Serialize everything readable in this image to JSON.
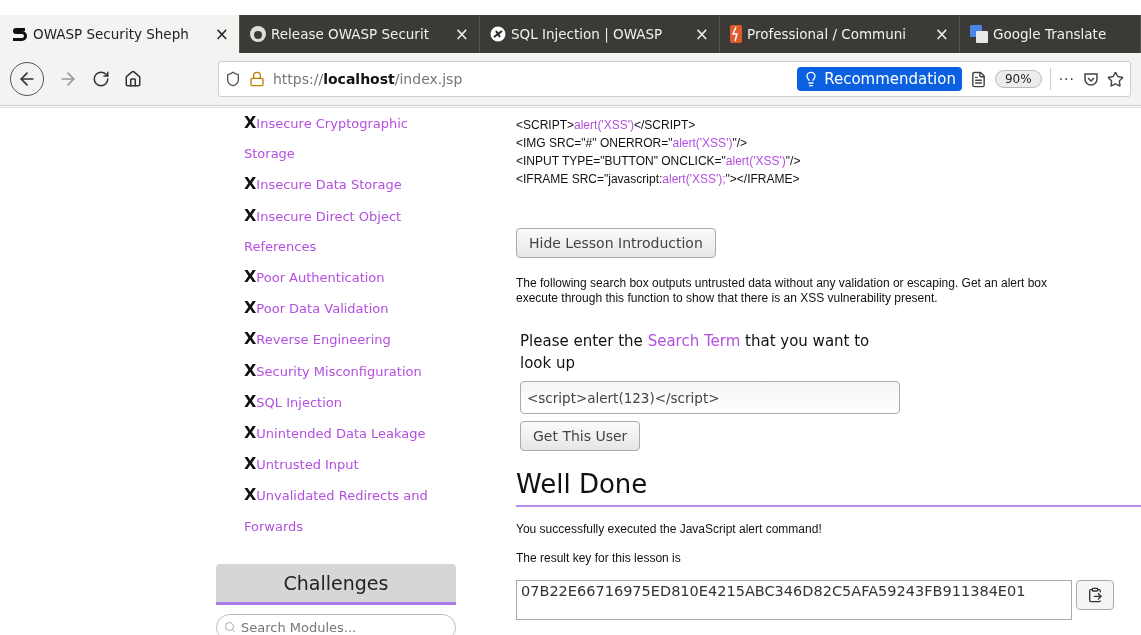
{
  "browser": {
    "tabs": [
      {
        "kind": "s-logo",
        "title": "OWASP Security Sheph",
        "selected": true,
        "close": "×"
      },
      {
        "kind": "github",
        "title": "Release OWASP Securit",
        "selected": false,
        "close": "×"
      },
      {
        "kind": "owasp",
        "title": "SQL Injection | OWASP",
        "selected": false,
        "close": "×"
      },
      {
        "kind": "bitbucket",
        "title": "Professional / Communi",
        "selected": false,
        "close": "×"
      },
      {
        "kind": "translate",
        "title": "Google Translate",
        "selected": false
      }
    ],
    "url": {
      "scheme": "https://",
      "host": "localhost",
      "path": "/index.jsp"
    },
    "recommendation": "Recommendation",
    "zoom": "90%",
    "more": "···"
  },
  "sidebar": {
    "items": [
      {
        "mark": "X",
        "label": "Insecure Cryptographic Storage"
      },
      {
        "mark": "X",
        "label": "Insecure Data Storage"
      },
      {
        "mark": "X",
        "label": "Insecure Direct Object References"
      },
      {
        "mark": "X",
        "label": "Poor Authentication"
      },
      {
        "mark": "X",
        "label": "Poor Data Validation"
      },
      {
        "mark": "X",
        "label": "Reverse Engineering"
      },
      {
        "mark": "X",
        "label": "Security Misconfiguration"
      },
      {
        "mark": "X",
        "label": "SQL Injection"
      },
      {
        "mark": "X",
        "label": "Unintended Data Leakage"
      },
      {
        "mark": "X",
        "label": "Untrusted Input"
      },
      {
        "mark": "X",
        "label": "Unvalidated Redirects and Forwards"
      }
    ],
    "challenges": "Challenges",
    "search": {
      "placeholder": "Search Modules..."
    }
  },
  "lesson": {
    "code_lines": [
      [
        {
          "text": "<SCRIPT>",
          "highlight": false
        },
        {
          "text": "alert('XSS')",
          "highlight": true
        },
        {
          "text": "</SCRIPT>",
          "highlight": false
        }
      ],
      [
        {
          "text": "<IMG SRC=\"#\" ONERROR=\"",
          "highlight": false
        },
        {
          "text": "alert('XSS')",
          "highlight": true
        },
        {
          "text": "\"/>",
          "highlight": false
        }
      ],
      [
        {
          "text": "<INPUT TYPE=\"BUTTON\" ONCLICK=\"",
          "highlight": false
        },
        {
          "text": "alert('XSS')",
          "highlight": true
        },
        {
          "text": "\"/>",
          "highlight": false
        }
      ],
      [
        {
          "text": "<IFRAME SRC=\"javascript:",
          "highlight": false
        },
        {
          "text": "alert('XSS');",
          "highlight": true
        },
        {
          "text": "\"></IFRAME>",
          "highlight": false
        }
      ]
    ],
    "hide_button": "Hide Lesson Introduction",
    "description": [
      "The following search box outputs untrusted data without any validation or escaping. Get an alert box",
      "execute through this function to show that there is an XSS vulnerability present."
    ],
    "prompt": [
      {
        "text": "Please enter the ",
        "highlight": false
      },
      {
        "text": "Search Term",
        "highlight": true
      },
      {
        "text": " that you want to look up",
        "highlight": false
      }
    ],
    "search_value": "<script>alert(123)</script>",
    "submit_button": "Get This User",
    "result": {
      "title": "Well Done",
      "message": "You successfully executed the JavaScript alert command!",
      "key_label": "The result key for this lesson is",
      "key": "07B22E66716975ED810E4215ABC346D82C5AFA59243FB911384E01"
    }
  }
}
